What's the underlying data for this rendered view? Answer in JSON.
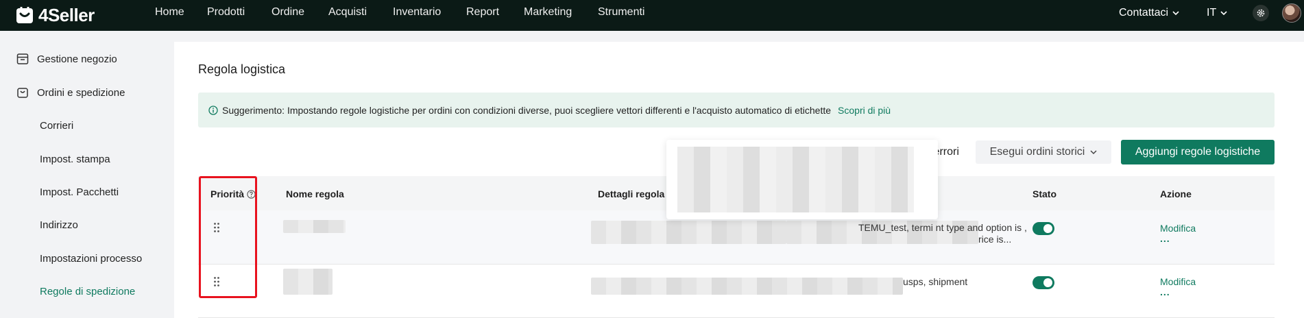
{
  "app": {
    "logo_text": "4Seller"
  },
  "nav": {
    "items": [
      "Home",
      "Prodotti",
      "Ordine",
      "Acquisti",
      "Inventario",
      "Report",
      "Marketing",
      "Strumenti"
    ],
    "contact_label": "Contattaci",
    "language_label": "IT"
  },
  "sidebar": {
    "group1": "Gestione negozio",
    "group2": "Ordini e spedizione",
    "sub_items": [
      "Corrieri",
      "Impost. stampa",
      "Impost. Pacchetti",
      "Indirizzo",
      "Impostazioni processo",
      "Regole di spedizione"
    ],
    "active_index": 5
  },
  "page": {
    "title": "Regola logistica",
    "tip_text": "Suggerimento: Impostando regole logistiche per ordini con condizioni diverse, puoi scegliere vettori differenti e l'acquisto automatico di etichette",
    "tip_link": "Scopri di più",
    "errors_label": "il errori",
    "history_button": "Esegui ordini storici",
    "add_button": "Aggiungi regole logistiche"
  },
  "table": {
    "columns": [
      "Priorità",
      "Nome regola",
      "Dettagli regola",
      "Stato",
      "Azione"
    ],
    "rows": [
      {
        "details_line1": "TEMU_test, termi      nt type and option is ,",
        "details_line2": "rice is...",
        "enabled": true,
        "action_label": "Modifica",
        "more_label": "..."
      },
      {
        "details_line1": "usps, shipment",
        "details_line2": "",
        "enabled": true,
        "action_label": "Modifica",
        "more_label": "..."
      }
    ]
  },
  "colors": {
    "accent": "#0f7a5f",
    "nav_bg": "#0b1a16",
    "highlight": "#e8121e"
  }
}
